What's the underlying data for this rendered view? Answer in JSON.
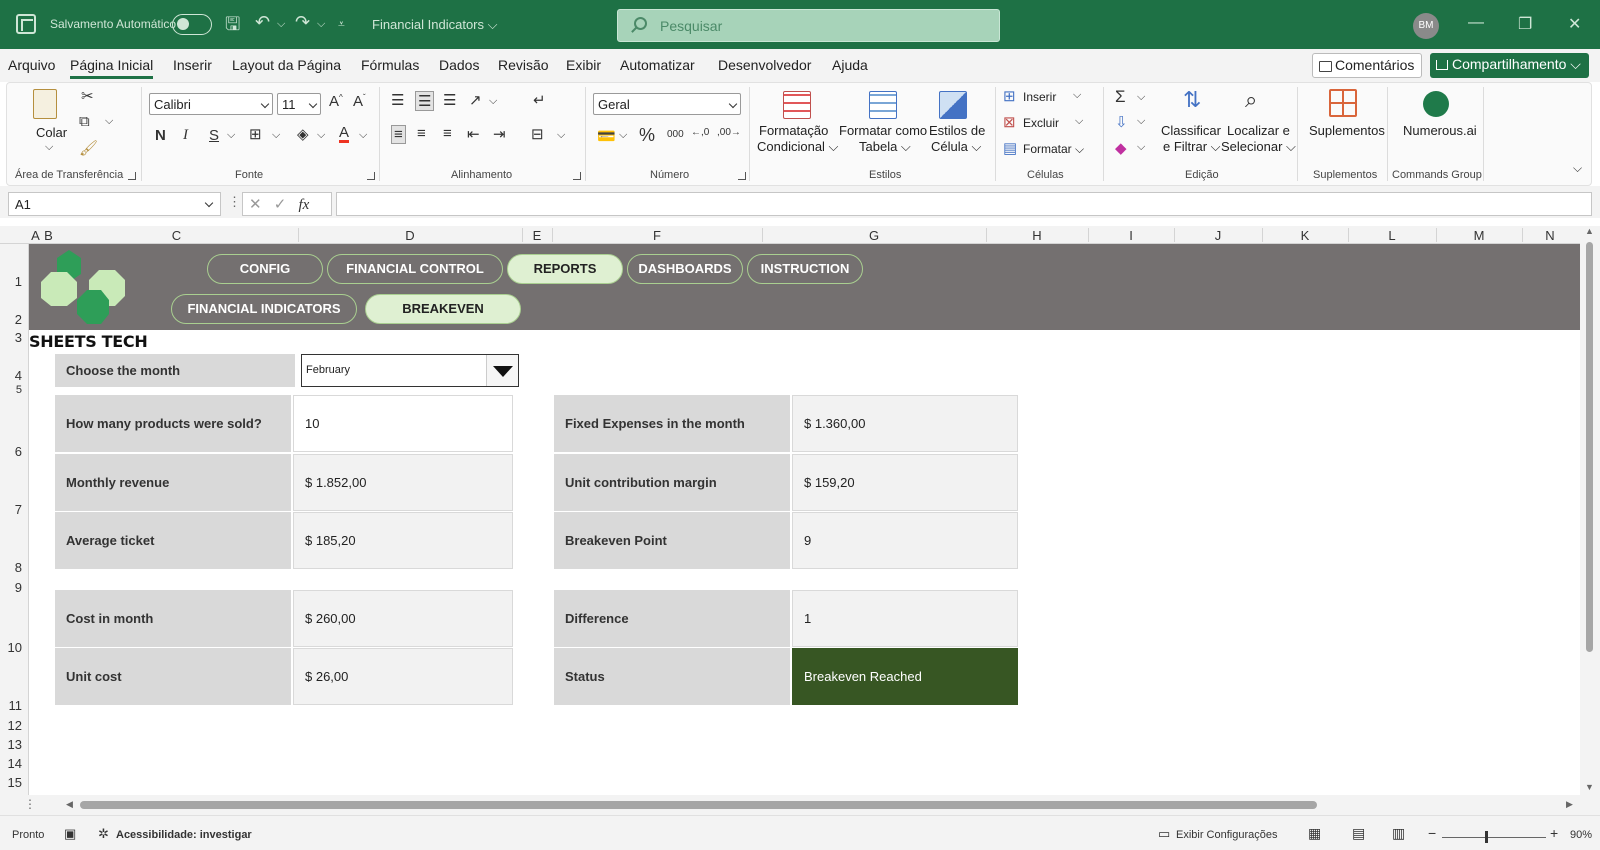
{
  "titlebar": {
    "autosave_label": "Salvamento Automático",
    "doc_title": "Financial Indicators ⌵",
    "search_placeholder": "Pesquisar",
    "avatar": "BM"
  },
  "menu": {
    "items": [
      "Arquivo",
      "Página Inicial",
      "Inserir",
      "Layout da Página",
      "Fórmulas",
      "Dados",
      "Revisão",
      "Exibir",
      "Automatizar",
      "Desenvolvedor",
      "Ajuda"
    ],
    "comments": "Comentários",
    "share": "Compartilhamento ⌵"
  },
  "ribbon": {
    "clipboard": {
      "paste": "Colar",
      "label": "Área de Transferência"
    },
    "font": {
      "name": "Calibri",
      "size": "11",
      "label": "Fonte"
    },
    "alignment": {
      "label": "Alinhamento"
    },
    "number": {
      "format": "Geral",
      "label": "Número"
    },
    "styles": {
      "conditional_1": "Formatação",
      "conditional_2": "Condicional ⌵",
      "table_1": "Formatar como",
      "table_2": "Tabela ⌵",
      "cell_1": "Estilos de",
      "cell_2": "Célula ⌵",
      "label": "Estilos"
    },
    "cells": {
      "insert": "Inserir",
      "delete": "Excluir",
      "format": "Formatar ⌵",
      "label": "Células"
    },
    "editing": {
      "sort_1": "Classificar",
      "sort_2": "e Filtrar ⌵",
      "find_1": "Localizar e",
      "find_2": "Selecionar ⌵",
      "label": "Edição"
    },
    "addins": {
      "button": "Suplementos",
      "label": "Suplementos"
    },
    "commands": {
      "button": "Numerous.ai",
      "label": "Commands Group"
    }
  },
  "formula_bar": {
    "name_box": "A1",
    "formula": ""
  },
  "columns": [
    "A",
    "B",
    "C",
    "D",
    "E",
    "F",
    "G",
    "H",
    "I",
    "J",
    "K",
    "L",
    "M",
    "N"
  ],
  "rows": [
    "1",
    "2",
    "3",
    "4",
    "5",
    "6",
    "7",
    "8",
    "9",
    "10",
    "11",
    "12",
    "13",
    "14",
    "15"
  ],
  "nav": {
    "row1": [
      "CONFIG",
      "FINANCIAL CONTROL",
      "REPORTS",
      "DASHBOARDS",
      "INSTRUCTION"
    ],
    "row2": [
      "FINANCIAL INDICATORS",
      "BREAKEVEN"
    ]
  },
  "brand": "SHEETS TECH",
  "month": {
    "label": "Choose the month",
    "value": "February"
  },
  "left_table": [
    {
      "label": "How many products were sold?",
      "value": "10"
    },
    {
      "label": "Monthly revenue",
      "value": "$ 1.852,00"
    },
    {
      "label": "Average ticket",
      "value": "$ 185,20"
    },
    {
      "label": "Cost in month",
      "value": "$ 260,00"
    },
    {
      "label": "Unit cost",
      "value": "$ 26,00"
    }
  ],
  "right_table": [
    {
      "label": "Fixed Expenses in the month",
      "value": "$ 1.360,00"
    },
    {
      "label": "Unit contribution margin",
      "value": "$ 159,20"
    },
    {
      "label": "Breakeven Point",
      "value": "9"
    },
    {
      "label": "Difference",
      "value": "1"
    },
    {
      "label": "Status",
      "value": "Breakeven Reached"
    }
  ],
  "statusbar": {
    "ready": "Pronto",
    "accessibility": "Acessibilidade: investigar",
    "display_settings": "Exibir Configurações",
    "zoom": "90%"
  },
  "colors": {
    "excel_green": "#1e7145",
    "banner": "#747070",
    "status_ok": "#375623",
    "pill_active": "#dff0d2"
  }
}
